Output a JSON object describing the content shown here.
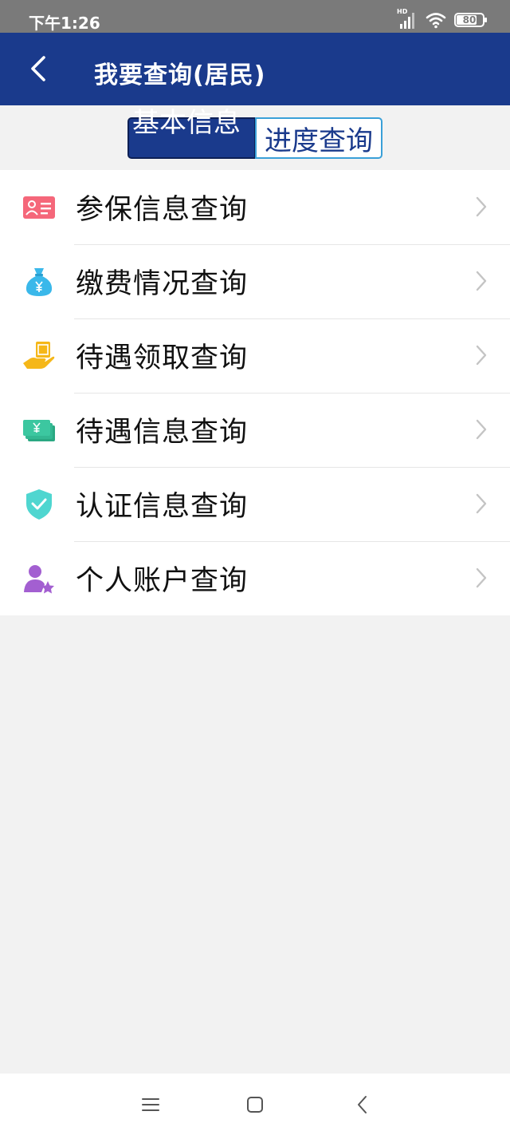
{
  "status_bar": {
    "time": "下午1:26",
    "network_badge": "HD",
    "battery_level": "80",
    "battery_fraction": 0.8
  },
  "header": {
    "title": "我要查询(居民)",
    "back_icon": "chevron-left-icon"
  },
  "tabs": [
    {
      "label": "基本信息",
      "active": true
    },
    {
      "label": "进度查询",
      "active": false
    }
  ],
  "menu": {
    "items": [
      {
        "label": "参保信息查询",
        "icon": "id-card-icon",
        "color": "#f5677a"
      },
      {
        "label": "缴费情况查询",
        "icon": "money-bag-icon",
        "color": "#3ab8ea"
      },
      {
        "label": "待遇领取查询",
        "icon": "hand-coin-icon",
        "color": "#f5b719"
      },
      {
        "label": "待遇信息查询",
        "icon": "banknotes-icon",
        "color": "#3cc7a0"
      },
      {
        "label": "认证信息查询",
        "icon": "shield-check-icon",
        "color": "#4fd6d0"
      },
      {
        "label": "个人账户查询",
        "icon": "user-star-icon",
        "color": "#a35fd1"
      }
    ]
  },
  "colors": {
    "primary": "#1a3a8c",
    "tab_border": "#3aa0d8",
    "background": "#f2f2f2"
  },
  "nav": {
    "menu_icon": "hamburger-icon",
    "home_icon": "square-icon",
    "back_icon": "triangle-back-icon"
  }
}
